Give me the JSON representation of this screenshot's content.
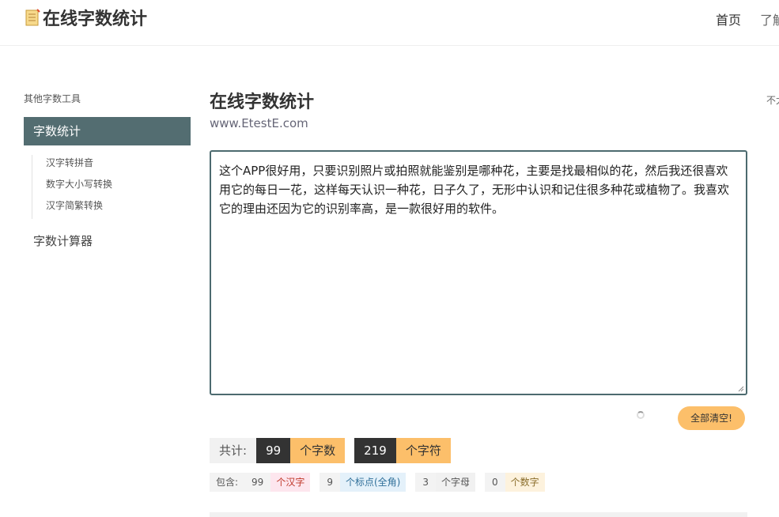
{
  "header": {
    "logo_text": "在线字数统计",
    "nav": [
      "首页",
      "了解"
    ]
  },
  "sidebar": {
    "title": "其他字数工具",
    "active_item": "字数统计",
    "sub_items": [
      "汉字转拼音",
      "数字大小写转换",
      "汉字简繁转换"
    ],
    "other_item": "字数计算器"
  },
  "main": {
    "title": "在线字数统计",
    "subtitle": "www.EtestE.com",
    "text": "这个APP很好用，只要识别照片或拍照就能鉴别是哪种花，主要是找最相似的花，然后我还很喜欢用它的每日一花，这样每天认识一种花，日子久了，无形中认识和记住很多种花或植物了。我喜欢它的理由还因为它的识别率高，是一款很好用的软件。",
    "clear_button": "全部清空!",
    "totals_label": "共计:",
    "word_count": "99",
    "word_unit": "个字数",
    "char_count": "219",
    "char_unit": "个字符",
    "breakdown_label": "包含:",
    "han_count": "99",
    "han_unit": "个汉字",
    "punct_count": "9",
    "punct_unit": "个标点(全角)",
    "letter_count": "3",
    "letter_unit": "个字母",
    "digit_count": "0",
    "digit_unit": "个数字"
  },
  "right_panel": {
    "cut_text": "不太"
  },
  "colors": {
    "accent": "#536d71",
    "highlight": "#fcbf6a",
    "dark": "#333333"
  }
}
